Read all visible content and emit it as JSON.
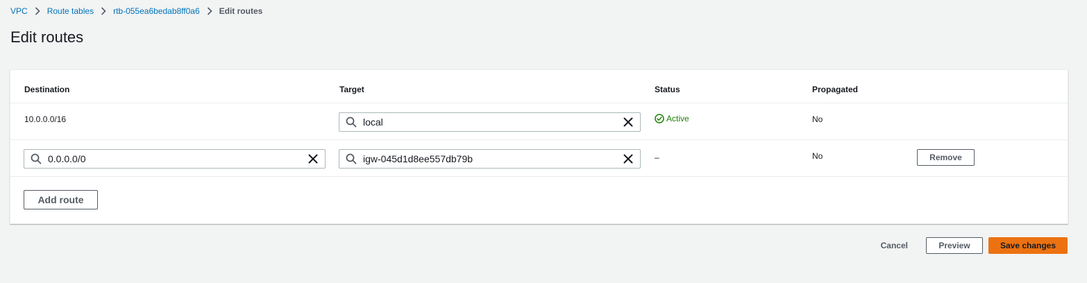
{
  "breadcrumb": {
    "items": [
      {
        "label": "VPC"
      },
      {
        "label": "Route tables"
      },
      {
        "label": "rtb-055ea6bedab8ff0a6"
      }
    ],
    "current": "Edit routes"
  },
  "page": {
    "title": "Edit routes"
  },
  "table": {
    "columns": {
      "destination": "Destination",
      "target": "Target",
      "status": "Status",
      "propagated": "Propagated"
    },
    "rows": [
      {
        "destination": "10.0.0.0/16",
        "target": "local",
        "status": "Active",
        "propagated": "No"
      },
      {
        "destination": "0.0.0.0/0",
        "target": "igw-045d1d8ee557db79b",
        "status": "–",
        "propagated": "No",
        "remove_label": "Remove"
      }
    ],
    "add_route_label": "Add route"
  },
  "footer": {
    "cancel_label": "Cancel",
    "preview_label": "Preview",
    "save_label": "Save changes"
  },
  "colors": {
    "link": "#0073bb",
    "active_status": "#1d8102",
    "primary_button": "#ec7211",
    "page_background": "#f2f3f3"
  },
  "icons": {
    "search": "search-icon",
    "clear": "close-icon",
    "status": "check-circle-icon",
    "separator": "chevron-right-icon"
  }
}
